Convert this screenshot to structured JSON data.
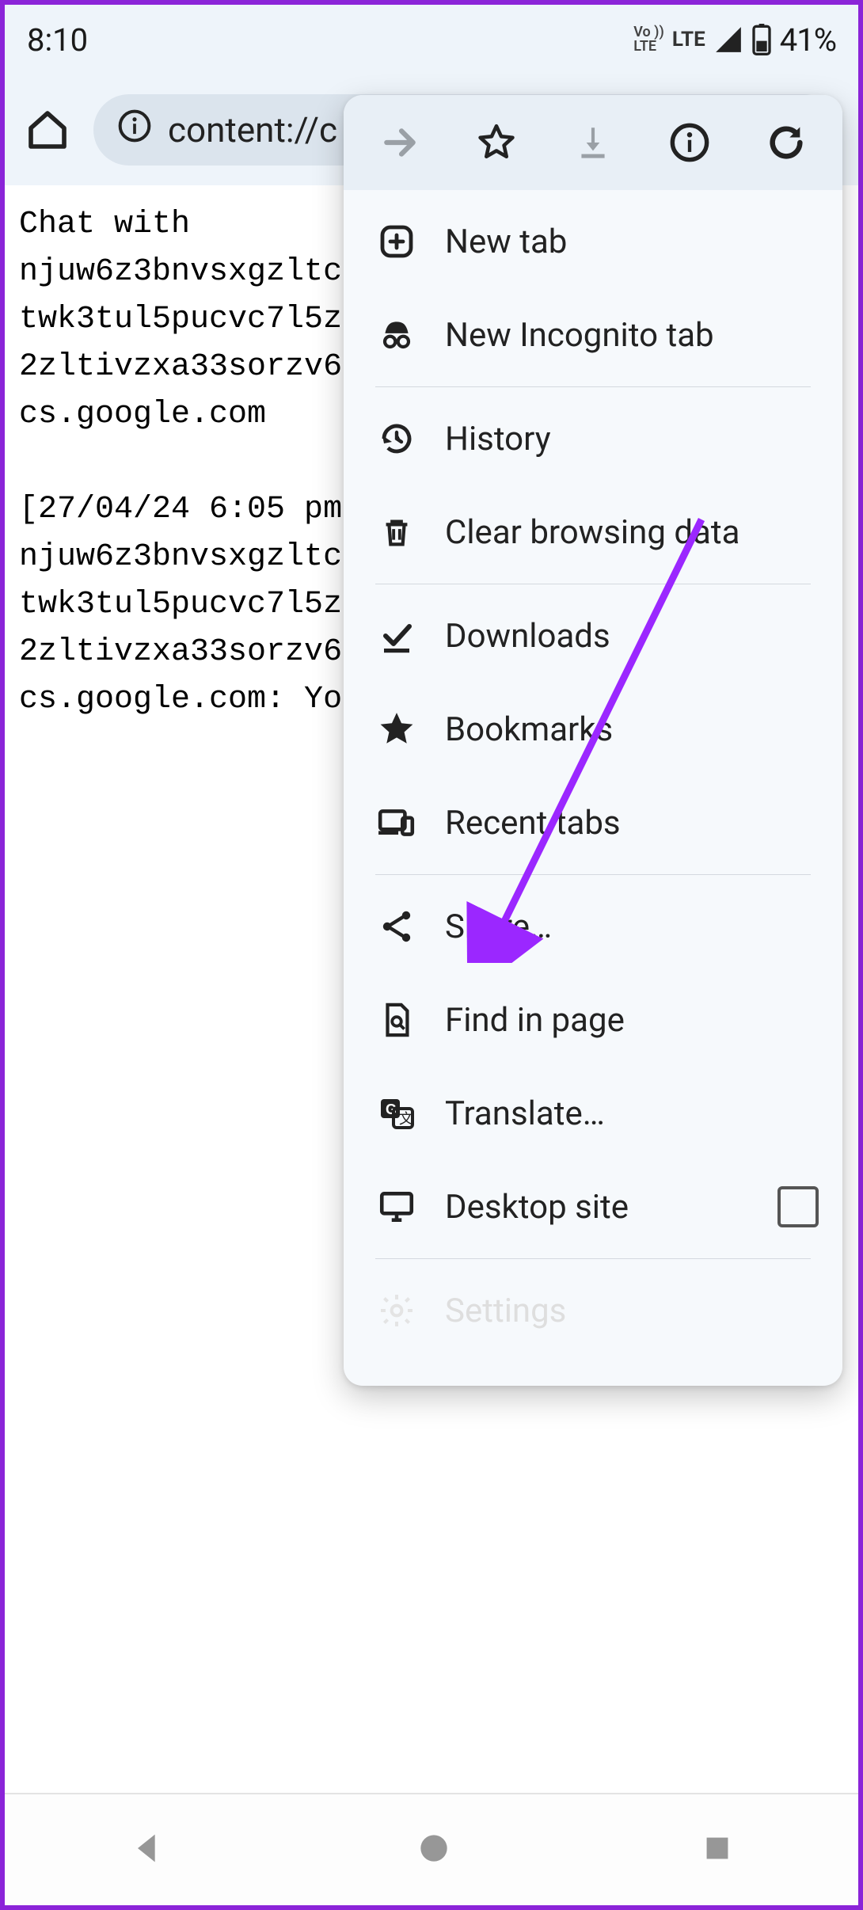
{
  "status": {
    "time": "8:10",
    "volte_top": "Vo ))",
    "volte_bottom": "LTE",
    "lte": "LTE",
    "battery": "41%"
  },
  "omnibox": {
    "url": "content://c"
  },
  "content": {
    "line1": "Chat with",
    "line2": "njuw6z3bnvsxgzltc",
    "line3": "twk3tul5pucvc7l5z",
    "line4": "2zltivzxa33sorzv6",
    "line5": "cs.google.com",
    "blank": "",
    "line6": "[27/04/24 6:05 pm",
    "line7": "njuw6z3bnvsxgzltc",
    "line8": "twk3tul5pucvc7l5z",
    "line9": "2zltivzxa33sorzv6",
    "line10": "cs.google.com: Yo"
  },
  "menu": {
    "new_tab": "New tab",
    "incognito": "New Incognito tab",
    "history": "History",
    "clear": "Clear browsing data",
    "downloads": "Downloads",
    "bookmarks": "Bookmarks",
    "recent": "Recent tabs",
    "share": "Share…",
    "find": "Find in page",
    "translate": "Translate…",
    "desktop": "Desktop site",
    "settings": "Settings"
  }
}
